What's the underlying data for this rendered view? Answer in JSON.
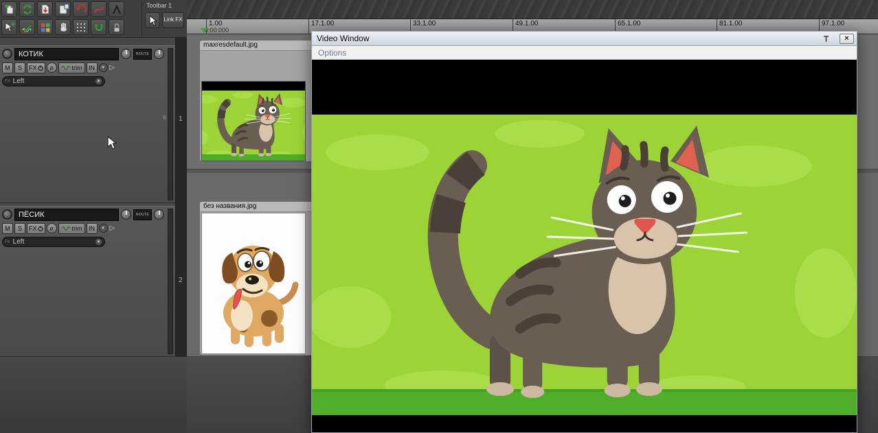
{
  "toolbar": {
    "group_label": "Toolbar 1",
    "link_fx_label": "Link FX",
    "icons_row1": [
      "new-project-icon",
      "sync-arrows-icon",
      "save-item-icon",
      "project-tab-icon",
      "undo-icon",
      "curve-tool-icon",
      "lambda-tool-icon"
    ],
    "icons_row2": [
      "edit-cursor-icon",
      "pencil-wave-icon",
      "multitool-grid-icon",
      "hand-tool-icon",
      "grid-dots-icon",
      "glue-icon",
      "lock-icon"
    ],
    "island_icons": [
      "pointer-tool-icon"
    ]
  },
  "glyphs": {
    "dropdown": "▼",
    "phase": "ø",
    "close": "×",
    "monitor": "▷"
  },
  "track_panel": {
    "meter_scale_label": "6",
    "tracks": [
      {
        "name": "КОТИК",
        "number": "1",
        "mute_label": "M",
        "solo_label": "S",
        "fx_label": "FX",
        "trim_label": "trim",
        "input_label": "IN",
        "route_label": "ROUTE",
        "fx_slot_label": "Left"
      },
      {
        "name": "ПЁСИК",
        "number": "2",
        "mute_label": "M",
        "solo_label": "S",
        "fx_label": "FX",
        "trim_label": "trim",
        "input_label": "IN",
        "route_label": "ROUTE",
        "fx_slot_label": "Left"
      }
    ]
  },
  "ruler": {
    "marks": [
      "1.00",
      "17.1.00",
      "33.1.00",
      "49.1.00",
      "65.1.00",
      "81.1.00",
      "97.1.00"
    ],
    "time_readout": "0:00.000"
  },
  "media_items": [
    {
      "filename": "maxresdefault.jpg"
    },
    {
      "filename": "без названия.jpg"
    }
  ],
  "video_window": {
    "title": "Video Window",
    "menu": {
      "options_label": "Options"
    }
  },
  "colors": {
    "scene_green": "#9cd437",
    "scene_green_light": "#abdc49",
    "ground_green": "#4fae29",
    "cat_body": "#6a5d52",
    "cat_stripe": "#4b4038",
    "cat_cream": "#d8c4aa",
    "nose_red": "#e0554d",
    "dog_body": "#dfa964",
    "dog_ear": "#7d4c20"
  }
}
